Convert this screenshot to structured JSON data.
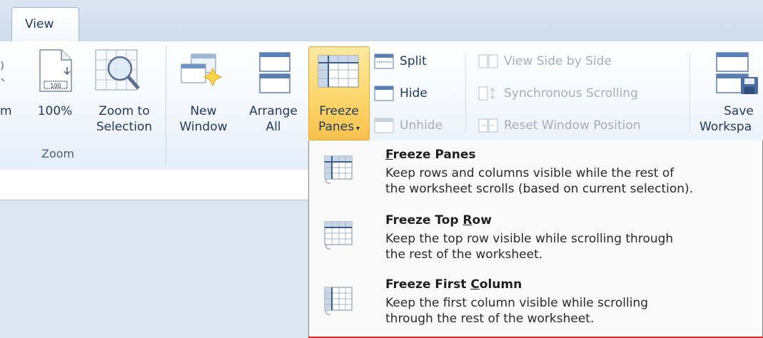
{
  "tabs": {
    "active": "View"
  },
  "zoom_group": {
    "partial_label": "m",
    "hundred_label": "100%",
    "zoom_selection_line1": "Zoom to",
    "zoom_selection_line2": "Selection",
    "group_label": "Zoom"
  },
  "window_group": {
    "new_window_line1": "New",
    "new_window_line2": "Window",
    "arrange_all_line1": "Arrange",
    "arrange_all_line2": "All",
    "freeze_panes_line1": "Freeze",
    "freeze_panes_line2": "Panes",
    "split_label": "Split",
    "hide_label": "Hide",
    "unhide_label": "Unhide",
    "view_side_by_side_label": "View Side by Side",
    "synchronous_scrolling_label": "Synchronous Scrolling",
    "reset_window_position_label": "Reset Window Position",
    "save_workspace_line1": "Save",
    "save_workspace_line2": "Workspa"
  },
  "freeze_menu": {
    "items": [
      {
        "title_accel": "F",
        "title_rest": "reeze Panes",
        "desc_line1": "Keep rows and columns visible while the rest of",
        "desc_line2": "the worksheet scrolls (based on current selection)."
      },
      {
        "title_pre": "Freeze Top ",
        "title_accel": "R",
        "title_rest": "ow",
        "desc_line1": "Keep the top row visible while scrolling through",
        "desc_line2": "the rest of the worksheet."
      },
      {
        "title_pre": "Freeze First ",
        "title_accel": "C",
        "title_rest": "olumn",
        "desc_line1": "Keep the first column visible while scrolling",
        "desc_line2": "through the rest of the worksheet."
      }
    ]
  },
  "colors": {
    "highlight": "#fcd66b",
    "ribbon_text": "#1e395b",
    "disabled_text": "#a4aeba",
    "accent_red": "#d7242a"
  }
}
